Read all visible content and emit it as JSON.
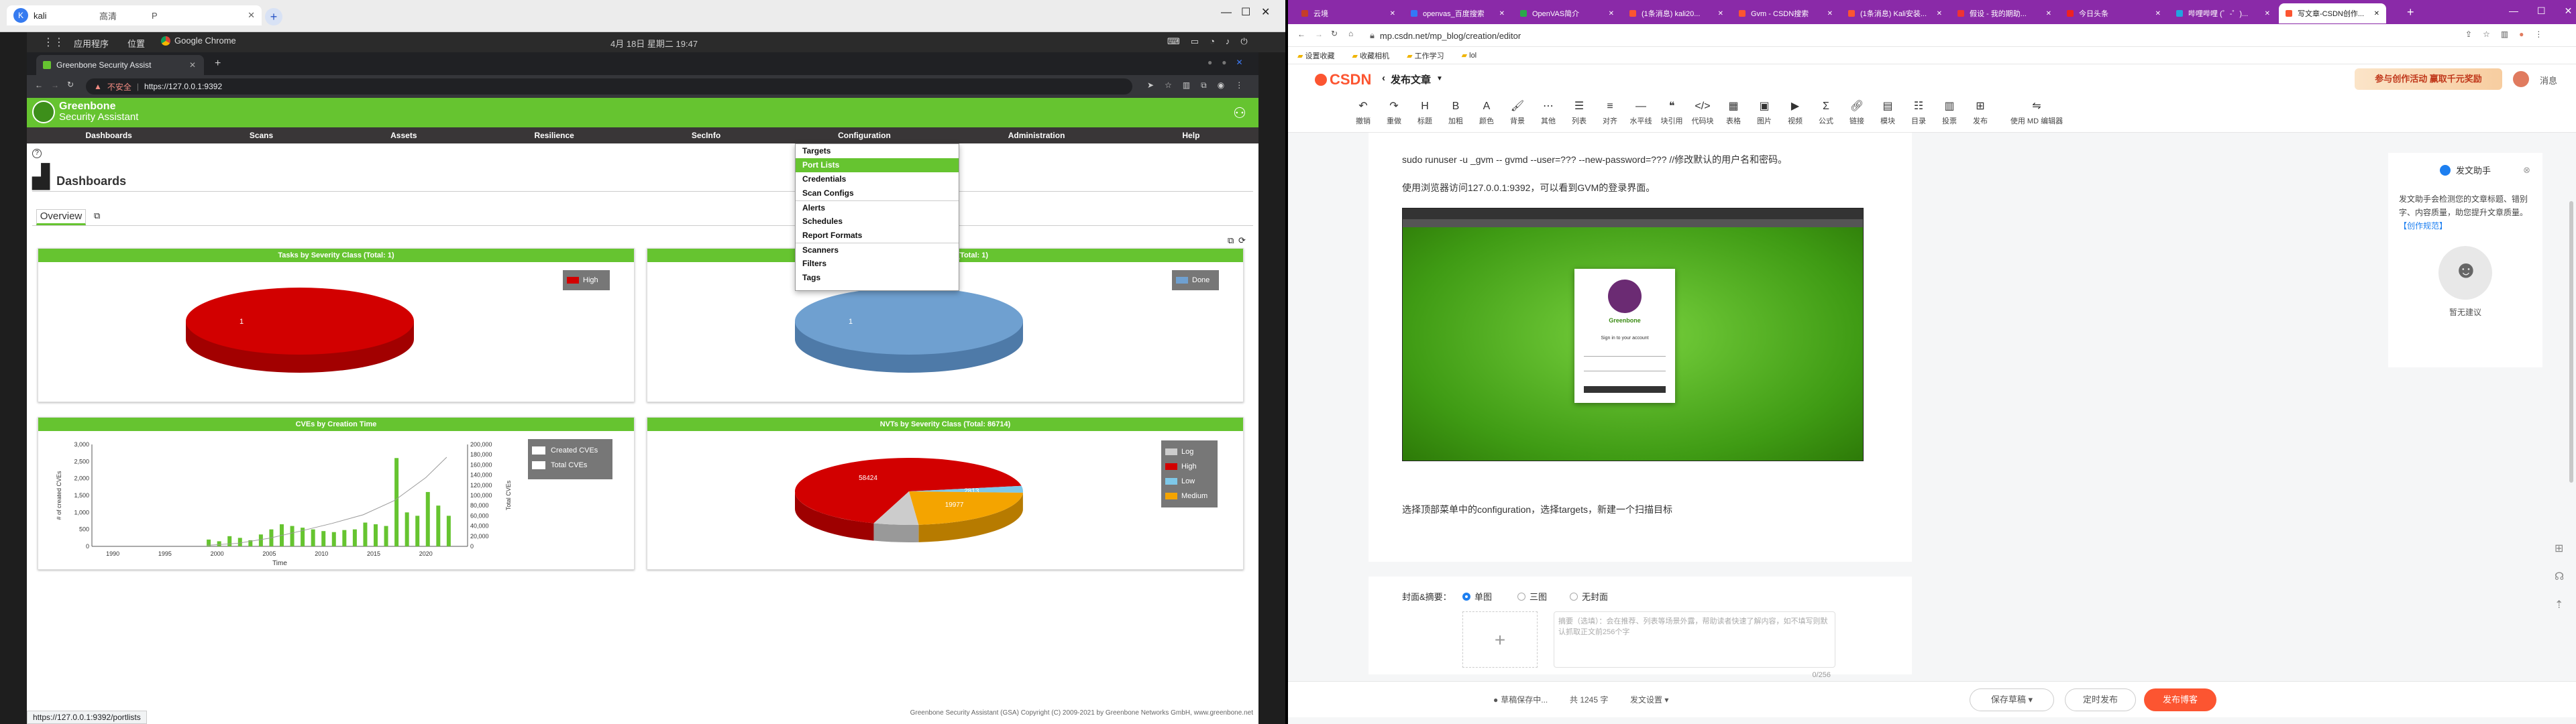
{
  "vm_window": {
    "tab_title": "kali",
    "tab_subtitle": "高清",
    "tab_extra": "P",
    "new_tab_label": "+"
  },
  "kali_panel": {
    "menu_apps": "应用程序",
    "menu_places": "位置",
    "menu_chrome": "Google Chrome",
    "clock": "4月  18日 星期二 19:47"
  },
  "guest_browser": {
    "tab_title": "Greenbone Security Assist",
    "security_label": "不安全",
    "url": "https://127.0.0.1:9392",
    "status_url": "https://127.0.0.1:9392/portlists"
  },
  "gsa": {
    "brand_line1": "Greenbone",
    "brand_line2": "Security Assistant",
    "nav": [
      "Dashboards",
      "Scans",
      "Assets",
      "Resilience",
      "SecInfo",
      "Configuration",
      "Administration",
      "Help"
    ],
    "page_title": "Dashboards",
    "tab_overview": "Overview",
    "config_menu": [
      "Targets",
      "Port Lists",
      "Credentials",
      "Scan Configs",
      "Alerts",
      "Schedules",
      "Report Formats",
      "Scanners",
      "Filters",
      "Tags"
    ],
    "config_menu_active": "Port Lists",
    "footer": "Greenbone Security Assistant (GSA) Copyright (C) 2009-2021 by Greenbone Networks GmbH, www.greenbone.net",
    "panels": {
      "tasks_title": "Tasks by Severity Class (Total: 1)",
      "tasks_legend": "High",
      "tasks_value": "1",
      "status_title": "(Total: 1)",
      "status_legend": "Done",
      "status_value": "1",
      "cves_title": "CVEs by Creation Time",
      "cves_legend_1": "Created CVEs",
      "cves_legend_2": "Total CVEs",
      "cves_xlabel": "Time",
      "cves_ylabel_left": "# of created CVEs",
      "cves_ylabel_right": "Total CVEs",
      "nvts_title": "NVTs by Severity Class (Total: 86714)",
      "nvts_legend": [
        "Log",
        "High",
        "Low",
        "Medium"
      ]
    }
  },
  "chart_data": [
    {
      "type": "pie",
      "title": "Tasks by Severity Class (Total: 1)",
      "labels": [
        "High"
      ],
      "values": [
        1
      ],
      "colors": [
        "#d20000"
      ]
    },
    {
      "type": "pie",
      "title": "(Total: 1)",
      "labels": [
        "Done"
      ],
      "values": [
        1
      ],
      "colors": [
        "#6fa0d0"
      ]
    },
    {
      "type": "pie",
      "title": "NVTs by Severity Class (Total: 86714)",
      "labels": [
        "High",
        "Low",
        "Medium",
        "Log"
      ],
      "values": [
        58424,
        2813,
        19977,
        5500
      ],
      "data_labels": [
        "58424",
        "2813",
        "19977",
        ""
      ],
      "colors": [
        "#d20000",
        "#7ec8e8",
        "#f4a400",
        "#cccccc"
      ]
    },
    {
      "type": "bar",
      "title": "CVEs by Creation Time",
      "xlabel": "Time",
      "ylabel": "# of created CVEs",
      "x_ticks": [
        "1990",
        "1995",
        "2000",
        "2005",
        "2010",
        "2015",
        "2020"
      ],
      "y_ticks_left": [
        "0",
        "500",
        "1,000",
        "1,500",
        "2,000",
        "2,500",
        "3,000"
      ],
      "y_ticks_right": [
        "0",
        "20,000",
        "40,000",
        "60,000",
        "80,000",
        "100,000",
        "120,000",
        "140,000",
        "160,000",
        "180,000",
        "200,000"
      ],
      "ylim": [
        0,
        3000
      ],
      "y2lim": [
        0,
        200000
      ],
      "series": [
        {
          "name": "Created CVEs",
          "type": "bar"
        },
        {
          "name": "Total CVEs",
          "type": "line"
        }
      ],
      "bar_years": [
        1999,
        2000,
        2001,
        2002,
        2003,
        2004,
        2005,
        2006,
        2007,
        2008,
        2009,
        2010,
        2011,
        2012,
        2013,
        2014,
        2015,
        2016,
        2017,
        2018,
        2019,
        2020,
        2021,
        2022
      ],
      "bar_values": [
        200,
        150,
        300,
        250,
        180,
        350,
        500,
        650,
        600,
        550,
        500,
        450,
        420,
        480,
        500,
        700,
        650,
        600,
        2600,
        1000,
        900,
        1600,
        1200,
        900
      ],
      "line_years": [
        1999,
        2002,
        2005,
        2008,
        2011,
        2014,
        2017,
        2020,
        2022
      ],
      "line_values": [
        2000,
        6000,
        16000,
        30000,
        45000,
        62000,
        90000,
        135000,
        175000
      ]
    }
  ],
  "host_browser": {
    "tabs": [
      "云境",
      "openvas_百度搜索",
      "OpenVAS简介",
      "(1条消息) kali20...",
      "Gvm - CSDN搜索",
      "(1条消息) Kali安装...",
      "假设 - 我的期助...",
      "今日头条",
      "哔哩哔哩 (゜-゜)...",
      "写文章-CSDN创作..."
    ],
    "address": "mp.csdn.net/mp_blog/creation/editor",
    "bookmarks": [
      "设置收藏",
      "收藏相机",
      "工作学习",
      "lol"
    ]
  },
  "csdn": {
    "logo": "CSDN",
    "back_label": "发布文章",
    "banner": "参与创作活动 赢取千元奖励",
    "header_right": "消息",
    "toolbar": [
      "撤销",
      "重做",
      "标题",
      "加粗",
      "颜色",
      "背景",
      "其他",
      "列表",
      "对齐",
      "水平线",
      "块引用",
      "代码块",
      "表格",
      "图片",
      "视频",
      "公式",
      "链接",
      "模块",
      "目录",
      "投票",
      "发布",
      "使用 MD 编辑器"
    ],
    "para1": "sudo runuser -u _gvm -- gvmd --user=??? --new-password=??? //修改默认的用户名和密码。",
    "para2": "使用浏览器访问127.0.0.1:9392，可以看到GVM的登录界面。",
    "para3": "选择顶部菜单中的configuration，选择targets，新建一个扫描目标",
    "login_brand": "Greenbone",
    "login_sub": "Sign in to your account",
    "cover_label": "封面&摘要：",
    "cover_opts": [
      "单图",
      "三图",
      "无封面"
    ],
    "summary_placeholder": "摘要（选填）：会在推荐、列表等场景外露，帮助读者快速了解内容，如不填写则默认抓取正文前256个字",
    "summary_count": "0/256",
    "assistant_title": "发文助手",
    "assistant_text": "发文助手会检测您的文章标题、错别字、内容质量，助您提升文章质量。",
    "assistant_link": "【创作规范】",
    "assistant_empty": "暂无建议",
    "footer_save_status": "草稿保存中...",
    "footer_words": "共 1245 字",
    "footer_settings": "发文设置",
    "btn_save": "保存草稿",
    "btn_timed": "定时发布",
    "btn_publish": "发布博客"
  }
}
